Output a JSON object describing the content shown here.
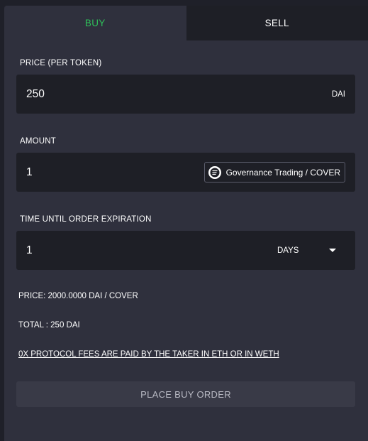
{
  "tabs": {
    "buy": "BUY",
    "sell": "SELL",
    "active": "buy"
  },
  "price": {
    "label": "PRICE (PER TOKEN)",
    "value": "250",
    "unit": "DAI"
  },
  "amount": {
    "label": "AMOUNT",
    "value": "1",
    "token": "Governance Trading / COVER",
    "token_icon": "token-logo-icon"
  },
  "expiration": {
    "label": "TIME UNTIL ORDER EXPIRATION",
    "value": "1",
    "unit_selected": "DAYS"
  },
  "summary": {
    "price_text": "PRICE: 2000.0000 DAI / COVER",
    "total_text": "TOTAL : 250 DAI",
    "fees_text": "0X PROTOCOL FEES ARE PAID BY THE TAKER IN ETH OR IN WETH"
  },
  "actions": {
    "place_order": "PLACE BUY ORDER"
  },
  "colors": {
    "active_tab": "#2fbf5a",
    "panel": "#2f303d",
    "field": "#1e1f26"
  }
}
